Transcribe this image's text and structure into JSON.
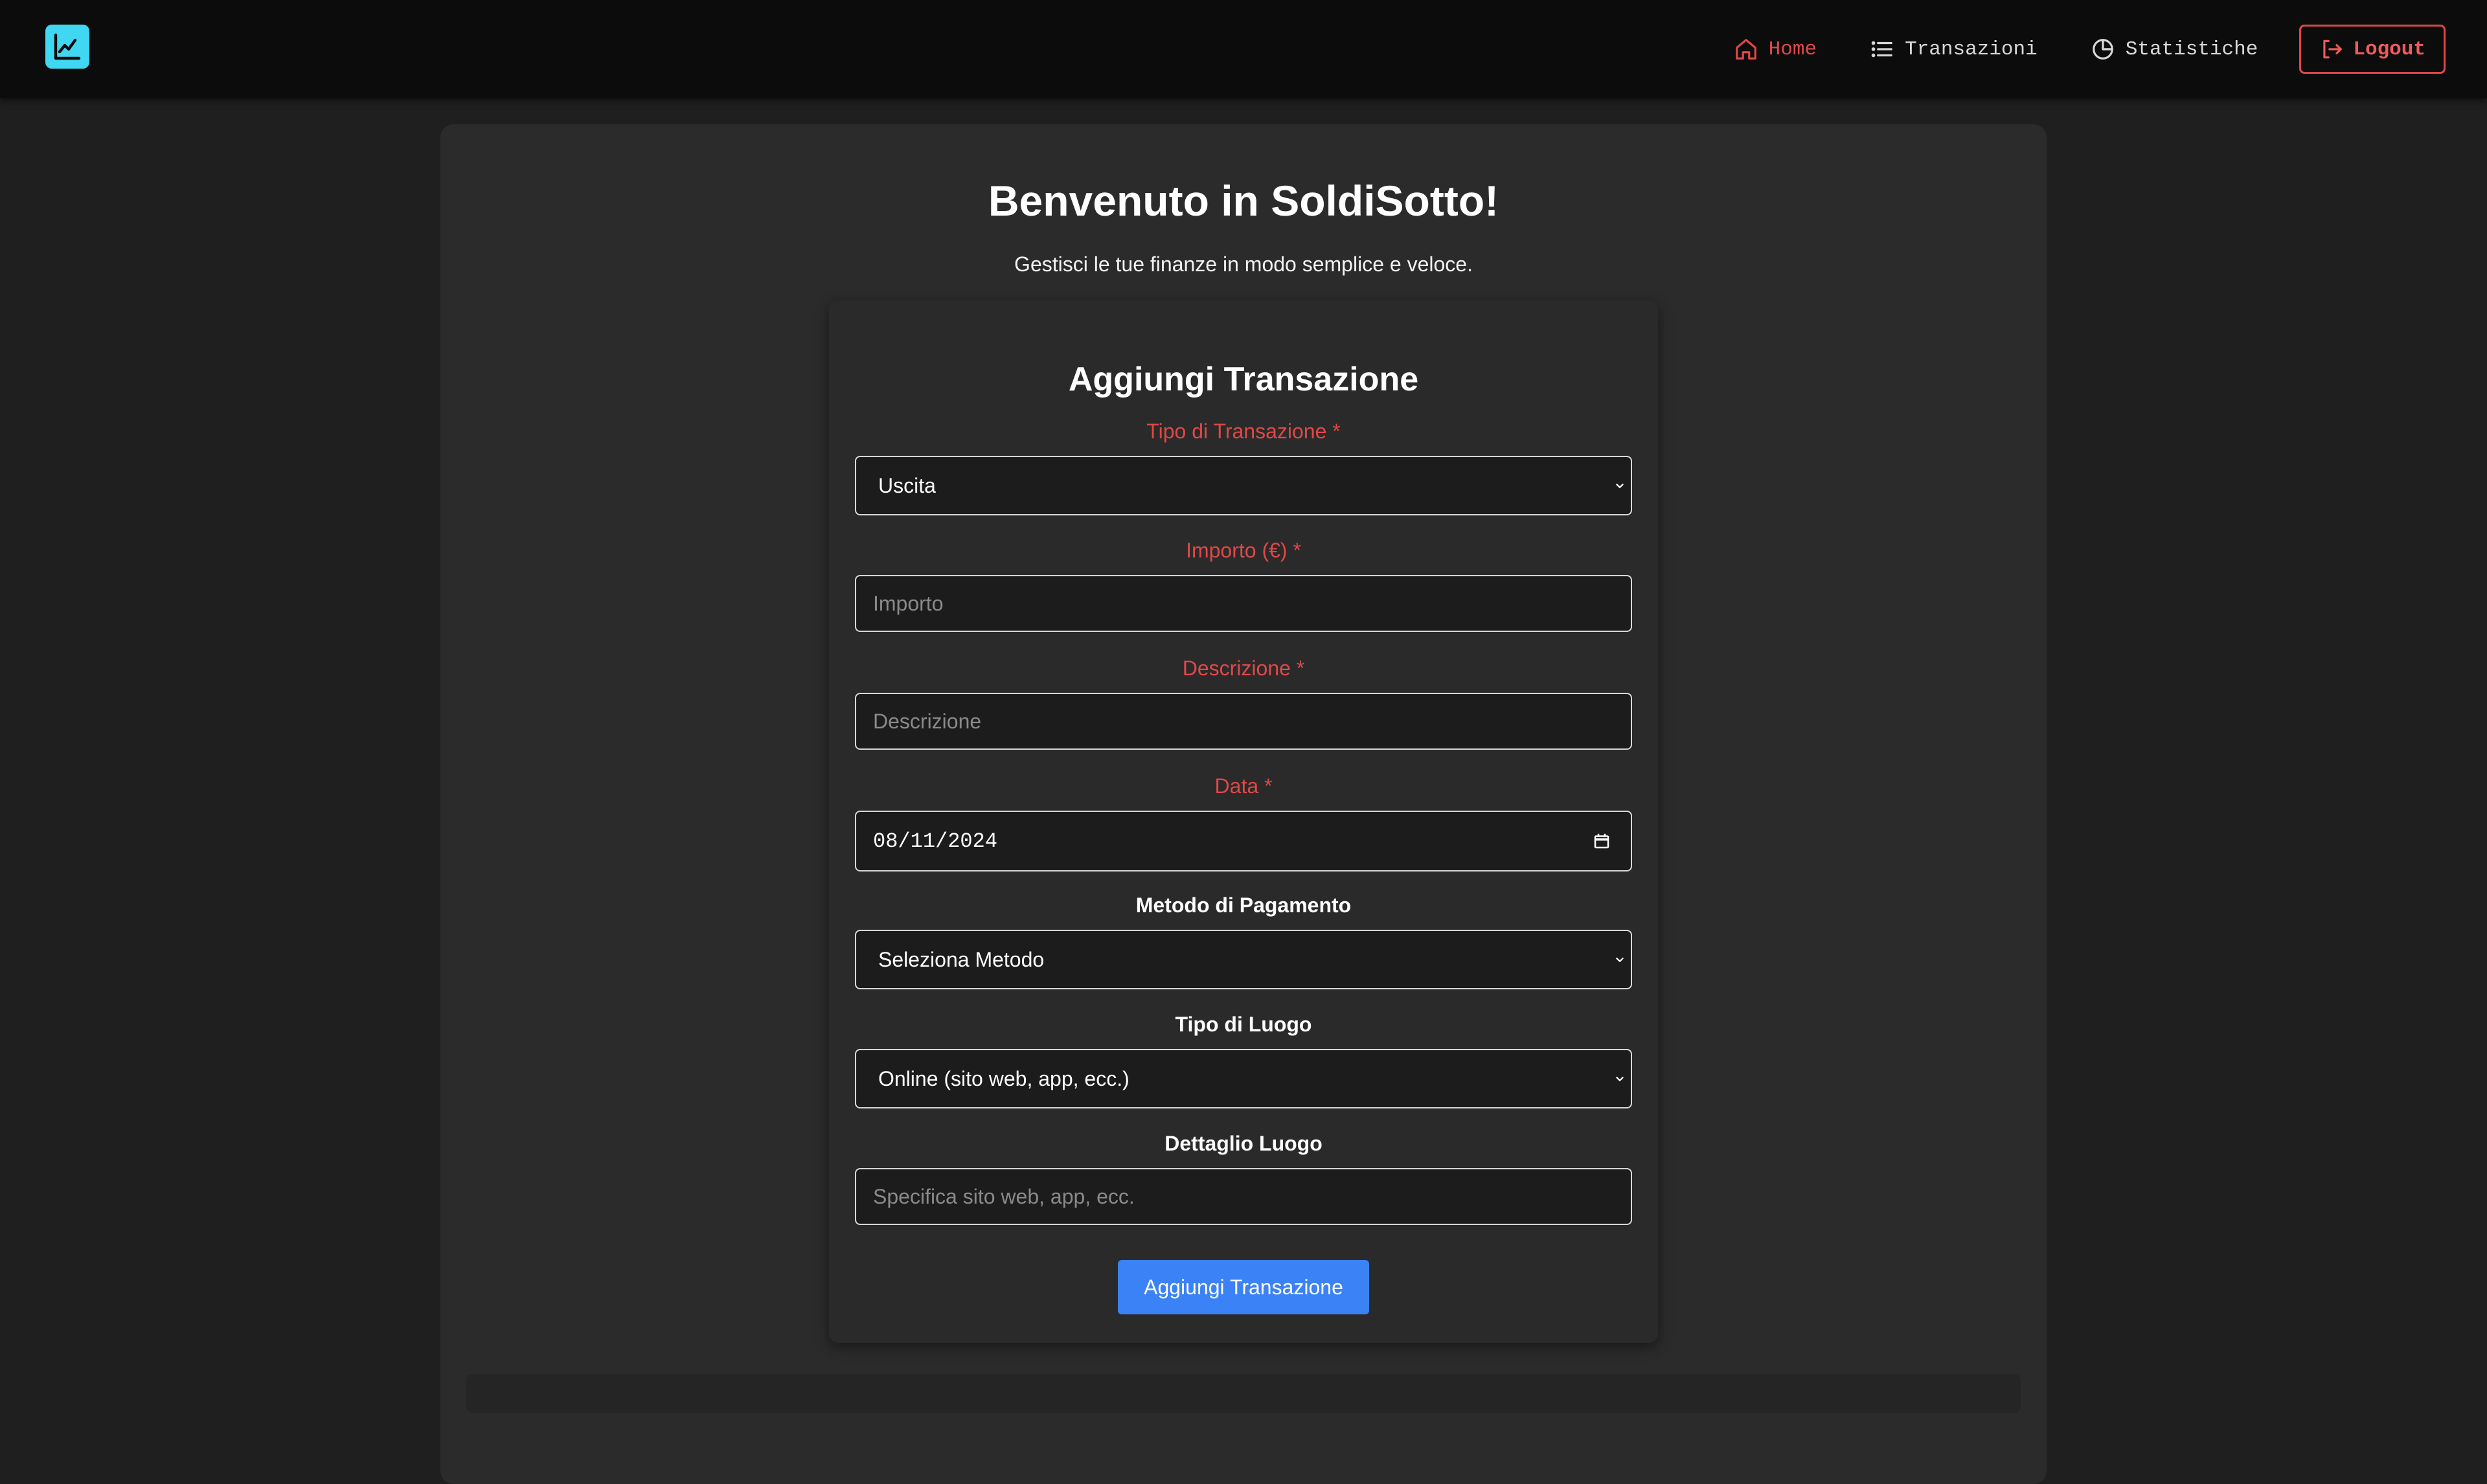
{
  "nav": {
    "items": [
      {
        "label": "Home",
        "icon": "home-icon",
        "active": true
      },
      {
        "label": "Transazioni",
        "icon": "list-icon",
        "active": false
      },
      {
        "label": "Statistiche",
        "icon": "pie-chart-icon",
        "active": false
      }
    ],
    "logout_label": "Logout"
  },
  "hero": {
    "title": "Benvenuto in SoldiSotto!",
    "subtitle": "Gestisci le tue finanze in modo semplice e veloce."
  },
  "form": {
    "title": "Aggiungi Transazione",
    "type_label": "Tipo di Transazione *",
    "type_value": "Uscita",
    "amount_label": "Importo (€) *",
    "amount_placeholder": "Importo",
    "description_label": "Descrizione *",
    "description_placeholder": "Descrizione",
    "date_label": "Data *",
    "date_value": "08/11/2024",
    "payment_label": "Metodo di Pagamento",
    "payment_value": "Seleziona Metodo",
    "place_type_label": "Tipo di Luogo",
    "place_type_value": "Online (sito web, app, ecc.)",
    "place_detail_label": "Dettaglio Luogo",
    "place_detail_placeholder": "Specifica sito web, app, ecc.",
    "submit_label": "Aggiungi Transazione"
  },
  "colors": {
    "accent_red": "#e04848",
    "primary_blue": "#3b82f6",
    "logo_cyan": "#3fd7f1"
  }
}
